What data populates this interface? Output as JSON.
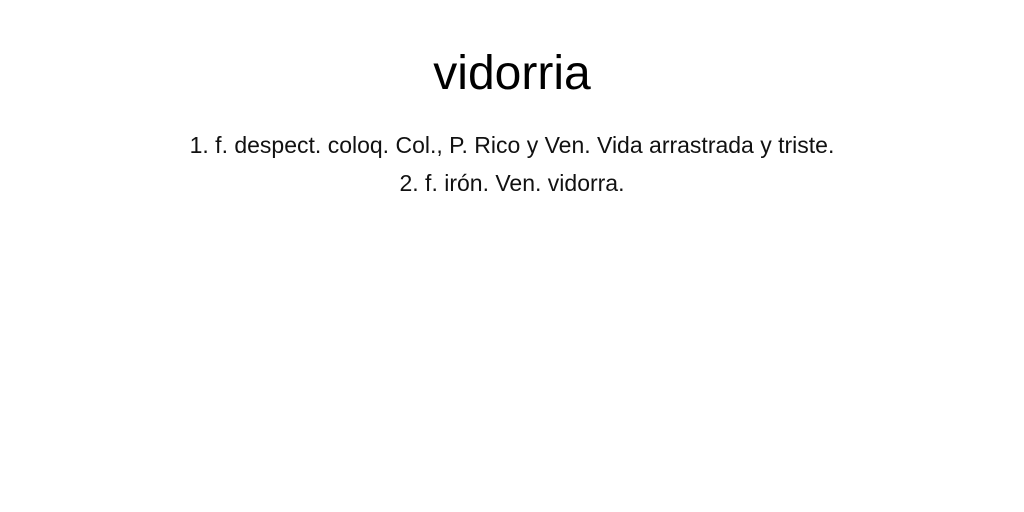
{
  "entry": {
    "headword": "vidorria",
    "senses": [
      "1. f. despect. coloq. Col., P. Rico y Ven. Vida arrastrada y triste.",
      "2. f. irón. Ven. vidorra."
    ]
  }
}
